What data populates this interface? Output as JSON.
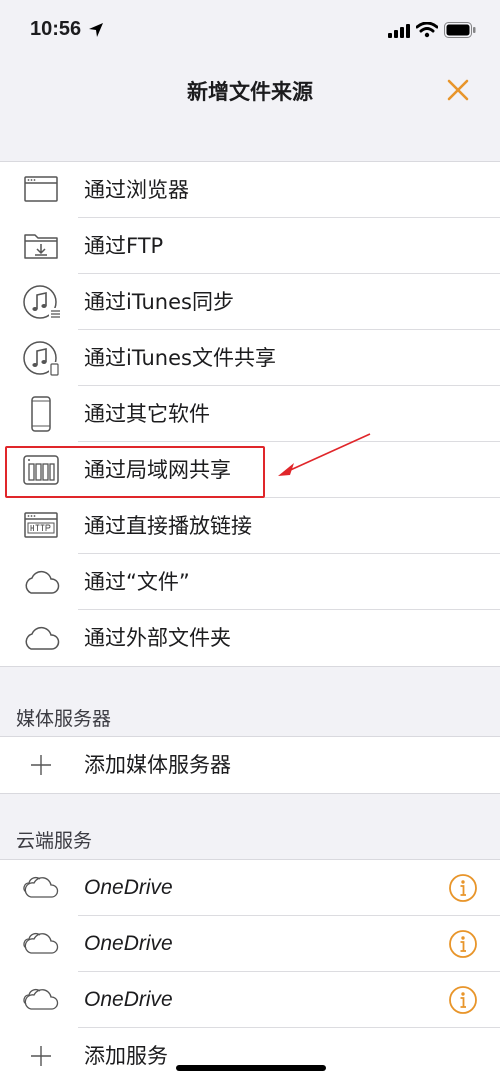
{
  "status": {
    "time": "10:56"
  },
  "nav": {
    "title": "新增文件来源"
  },
  "sources": [
    {
      "label": "通过浏览器",
      "icon": "browser-window-icon"
    },
    {
      "label": "通过FTP",
      "icon": "ftp-folder-icon"
    },
    {
      "label": "通过iTunes同步",
      "icon": "itunes-sync-icon"
    },
    {
      "label": "通过iTunes文件共享",
      "icon": "itunes-file-share-icon"
    },
    {
      "label": "通过其它软件",
      "icon": "phone-icon"
    },
    {
      "label": "通过局域网共享",
      "icon": "nas-drive-icon"
    },
    {
      "label": "通过直接播放链接",
      "icon": "http-link-icon"
    },
    {
      "label": "通过“文件”",
      "icon": "cloud-icon"
    },
    {
      "label": "通过外部文件夹",
      "icon": "cloud-icon"
    }
  ],
  "media": {
    "header": "媒体服务器",
    "add_label": "添加媒体服务器"
  },
  "cloud": {
    "header": "云端服务",
    "items": [
      {
        "label": "OneDrive"
      },
      {
        "label": "OneDrive"
      },
      {
        "label": "OneDrive"
      }
    ],
    "add_label": "添加服务"
  },
  "colors": {
    "accent": "#e8952a",
    "highlight": "#e0262a"
  }
}
